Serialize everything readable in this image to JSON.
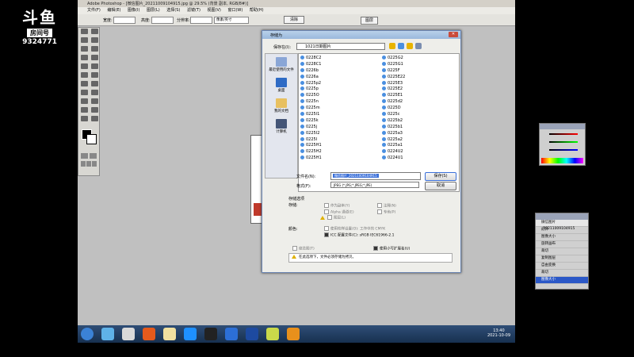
{
  "stream": {
    "logo_text": "斗鱼",
    "room_label": "房间号",
    "room_number": "9324771"
  },
  "photoshop": {
    "title": "Adobe Photoshop - [微信图片_20211009104915.jpg @ 29.5% (背景 副本, RGB/8#)]",
    "menu": [
      "文件(F)",
      "编辑(E)",
      "图像(I)",
      "图层(L)",
      "选择(S)",
      "滤镜(T)",
      "视图(V)",
      "窗口(W)",
      "帮助(H)"
    ],
    "options": {
      "width_label": "宽度:",
      "height_label": "高度:",
      "resolution_label": "分辨率:",
      "resolution_unit": "像素/英寸",
      "clear_button": "清除"
    },
    "panel_tab": "图层"
  },
  "dialog": {
    "title": "存储为",
    "save_in_label": "保存在(I):",
    "save_in_value": "1021日期图片",
    "places": [
      "最近使用的文件",
      "桌面",
      "我的文档",
      "计算机"
    ],
    "files_col1": [
      "0228C2",
      "0228C1",
      "0226b",
      "0226a",
      "0225p2",
      "0225p",
      "0225O",
      "0225n",
      "0225m",
      "0225l1",
      "0225k",
      "0225j",
      "0225I2",
      "0225I",
      "0225H1",
      "0225H2",
      "0225H1"
    ],
    "files_col2": [
      "0225G2",
      "0225G1",
      "0225F",
      "0225E22",
      "0225E3",
      "0225E2",
      "0225E1",
      "0225d2",
      "0225D",
      "0225c",
      "0225b2",
      "0225b1",
      "0225a3",
      "0225a2",
      "0225a1",
      "0224U2",
      "0224U1"
    ],
    "filename_label": "文件名(N):",
    "filename_value": "微信图片_20211009104915",
    "format_label": "格式(F):",
    "format_value": "JPEG (*.JPG;*.JPEG;*.JPE)",
    "save_button": "保存(S)",
    "cancel_button": "取消",
    "options_title": "存储选项",
    "store_label": "存储:",
    "store_options": [
      "作为副本(Y)",
      "注释(N)",
      "Alpha 通道(E)",
      "专色(P)",
      "图层(L)"
    ],
    "color_label": "颜色:",
    "color_options": [
      "使用校样设置(O): 工作中的 CMYK",
      "ICC 配置文件(C): sRGB IEC61966-2.1"
    ],
    "thumbnail_option": "缩览图(T)",
    "extension_option": "使用小写扩展名(U)",
    "warning": "在此选项下，文件必须存储为拷贝。"
  },
  "history": {
    "title": "微信图片_20211009104915",
    "items": [
      "打开",
      "图像大小",
      "旋转画布",
      "裁切",
      "复制图层",
      "自由变换",
      "裁切",
      "图像大小"
    ]
  },
  "taskbar": {
    "time": "13:40",
    "date": "2021-10-09"
  },
  "colors": {
    "desktop": "#c0c0c0",
    "taskbar": "#1f3a60",
    "accent": "#3a6fd8"
  }
}
